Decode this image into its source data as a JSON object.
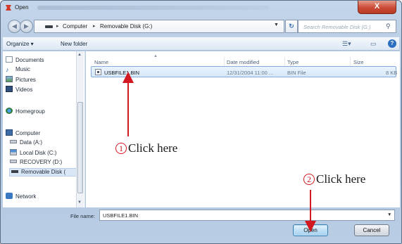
{
  "window": {
    "title": "Open",
    "close_label": "X"
  },
  "address": {
    "crumbs": [
      "Computer",
      "Removable Disk (G:)"
    ],
    "search_placeholder": "Search Removable Disk (G:)"
  },
  "toolbar": {
    "organize_label": "Organize ▾",
    "new_folder_label": "New folder"
  },
  "sidebar": {
    "items": [
      {
        "label": "Documents",
        "icon": "documents-icon"
      },
      {
        "label": "Music",
        "icon": "music-icon"
      },
      {
        "label": "Pictures",
        "icon": "pictures-icon"
      },
      {
        "label": "Videos",
        "icon": "videos-icon"
      },
      {
        "label": "Homegroup",
        "icon": "homegroup-icon"
      },
      {
        "label": "Computer",
        "icon": "computer-icon"
      },
      {
        "label": "Data (A:)",
        "icon": "drive-icon"
      },
      {
        "label": "Local Disk (C:)",
        "icon": "local-disk-icon"
      },
      {
        "label": "RECOVERY (D:)",
        "icon": "drive-icon"
      },
      {
        "label": "Removable Disk (",
        "icon": "usb-drive-icon"
      },
      {
        "label": "Network",
        "icon": "network-icon"
      }
    ]
  },
  "file_list": {
    "columns": [
      "Name",
      "Date modified",
      "Type",
      "Size"
    ],
    "rows": [
      {
        "name": "USBFILE1.BIN",
        "date": "12/31/2004 11:00 ...",
        "type": "BIN File",
        "size": "8 KB"
      }
    ]
  },
  "footer": {
    "filename_label": "File name:",
    "filename_value": "USBFILE1.BIN",
    "open_label": "Open",
    "cancel_label": "Cancel"
  },
  "annotations": [
    {
      "number": "1",
      "text": "Click here"
    },
    {
      "number": "2",
      "text": "Click here"
    }
  ],
  "colors": {
    "annotation_red": "#d21820",
    "selection_blue": "#d6e8fb"
  }
}
